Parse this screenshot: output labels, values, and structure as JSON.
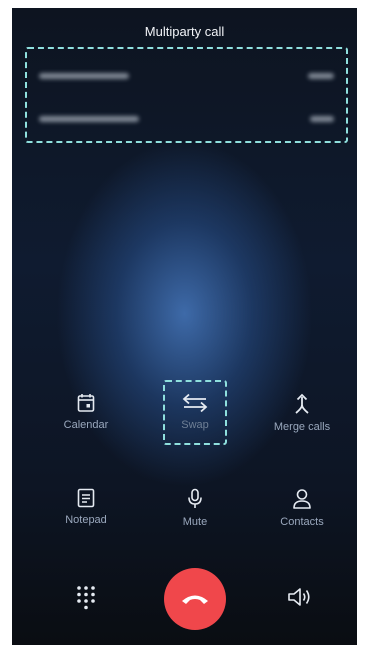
{
  "header": {
    "title": "Multiparty call"
  },
  "calls": [
    {
      "number": "",
      "status": ""
    },
    {
      "number": "",
      "status": ""
    }
  ],
  "controls": [
    {
      "id": "calendar",
      "label": "Calendar",
      "icon": "calendar-icon"
    },
    {
      "id": "swap",
      "label": "Swap",
      "icon": "swap-icon"
    },
    {
      "id": "merge",
      "label": "Merge calls",
      "icon": "merge-icon"
    },
    {
      "id": "notepad",
      "label": "Notepad",
      "icon": "notepad-icon"
    },
    {
      "id": "mute",
      "label": "Mute",
      "icon": "microphone-icon"
    },
    {
      "id": "contacts",
      "label": "Contacts",
      "icon": "person-icon"
    }
  ],
  "bottom": {
    "dialpad_icon": "dialpad-icon",
    "end_call_icon": "end-call-icon",
    "speaker_icon": "speaker-icon"
  },
  "colors": {
    "accent_highlight": "#8fe0de",
    "end_call": "#f0474b",
    "label_text": "#9aa8bd"
  }
}
